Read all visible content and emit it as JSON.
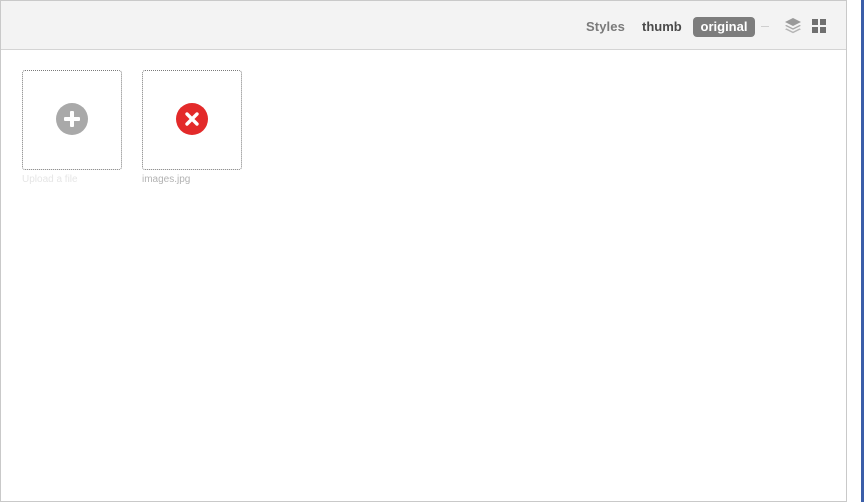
{
  "toolbar": {
    "styles_label": "Styles",
    "style_options": [
      {
        "label": "thumb",
        "selected": false
      },
      {
        "label": "original",
        "selected": true
      }
    ],
    "view_icons": [
      "layers-icon",
      "grid-icon"
    ]
  },
  "files": {
    "upload_tile": {
      "icon": "plus-circle-icon",
      "caption": "Upload a file"
    },
    "items": [
      {
        "icon": "remove-circle-icon",
        "caption": "images.jpg"
      }
    ]
  },
  "colors": {
    "toolbar_bg": "#f3f3f3",
    "selected_style_bg": "#7d7d7d",
    "remove_red": "#e32a2a",
    "upload_gray": "#a9a9a9",
    "window_edge": "#3b5ea9"
  }
}
